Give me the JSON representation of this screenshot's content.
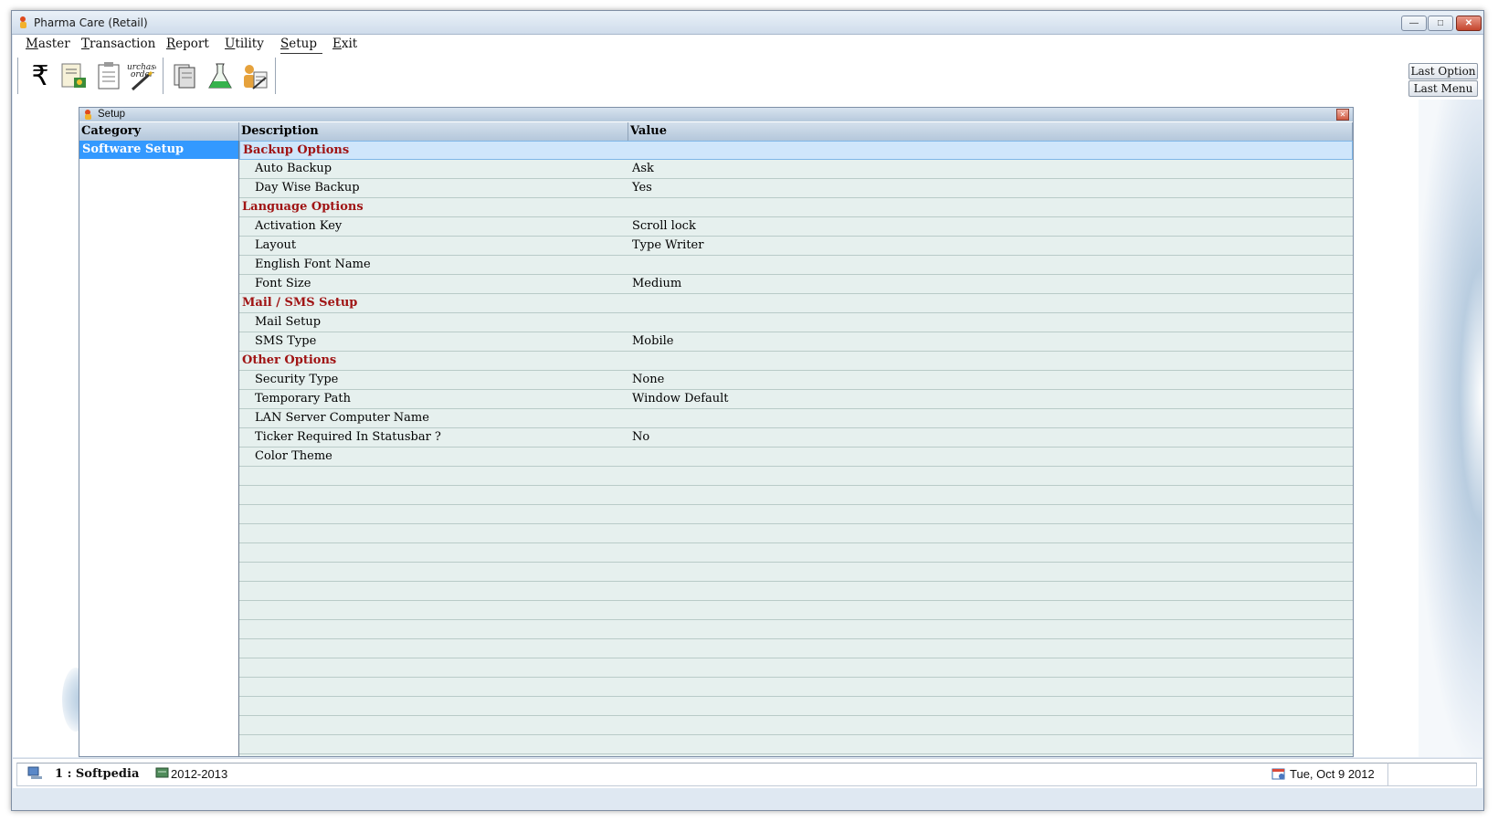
{
  "window": {
    "title": "Pharma Care (Retail)"
  },
  "menu": [
    {
      "label": "Master",
      "accel": "M",
      "rest": "aster"
    },
    {
      "label": "Transaction",
      "accel": "T",
      "rest": "ransaction"
    },
    {
      "label": "Report",
      "accel": "R",
      "rest": "eport"
    },
    {
      "label": "Utility",
      "accel": "U",
      "rest": "tility"
    },
    {
      "label": "Setup",
      "accel": "S",
      "rest": "etup"
    },
    {
      "label": "Exit",
      "accel": "E",
      "rest": "xit"
    }
  ],
  "toolbar": {
    "rupee_symbol": "₹",
    "purchase_label_1": "urchase",
    "purchase_label_2": "order",
    "last_option": "Last Option",
    "last_menu": "Last Menu"
  },
  "setup": {
    "title": "Setup",
    "headers": {
      "category": "Category",
      "description": "Description",
      "value": "Value"
    },
    "categories": [
      "Software Setup"
    ],
    "rows": [
      {
        "type": "group",
        "desc": "Backup Options",
        "value": ""
      },
      {
        "type": "item",
        "desc": "Auto Backup",
        "value": "Ask"
      },
      {
        "type": "item",
        "desc": "Day Wise Backup",
        "value": "Yes"
      },
      {
        "type": "group",
        "desc": "Language Options",
        "value": ""
      },
      {
        "type": "item",
        "desc": "Activation Key",
        "value": "Scroll lock"
      },
      {
        "type": "item",
        "desc": "Layout",
        "value": "Type Writer"
      },
      {
        "type": "item",
        "desc": "English Font Name",
        "value": ""
      },
      {
        "type": "item",
        "desc": "Font Size",
        "value": "Medium"
      },
      {
        "type": "group",
        "desc": "Mail / SMS Setup",
        "value": ""
      },
      {
        "type": "item",
        "desc": "Mail Setup",
        "value": ""
      },
      {
        "type": "item",
        "desc": "SMS Type",
        "value": "Mobile"
      },
      {
        "type": "group",
        "desc": "Other Options",
        "value": ""
      },
      {
        "type": "item",
        "desc": "Security Type",
        "value": "None"
      },
      {
        "type": "item",
        "desc": "Temporary Path",
        "value": "Window Default"
      },
      {
        "type": "item",
        "desc": "LAN Server Computer Name",
        "value": ""
      },
      {
        "type": "item",
        "desc": "Ticker Required In Statusbar ?",
        "value": "No"
      },
      {
        "type": "item",
        "desc": "Color Theme",
        "value": ""
      }
    ]
  },
  "status": {
    "user": "1 : Softpedia",
    "year": "2012-2013",
    "date": "Tue, Oct 9 2012"
  },
  "colors": {
    "group_text": "#a01414",
    "selection": "#3399ff",
    "grid_row": "#e6f0ee"
  }
}
